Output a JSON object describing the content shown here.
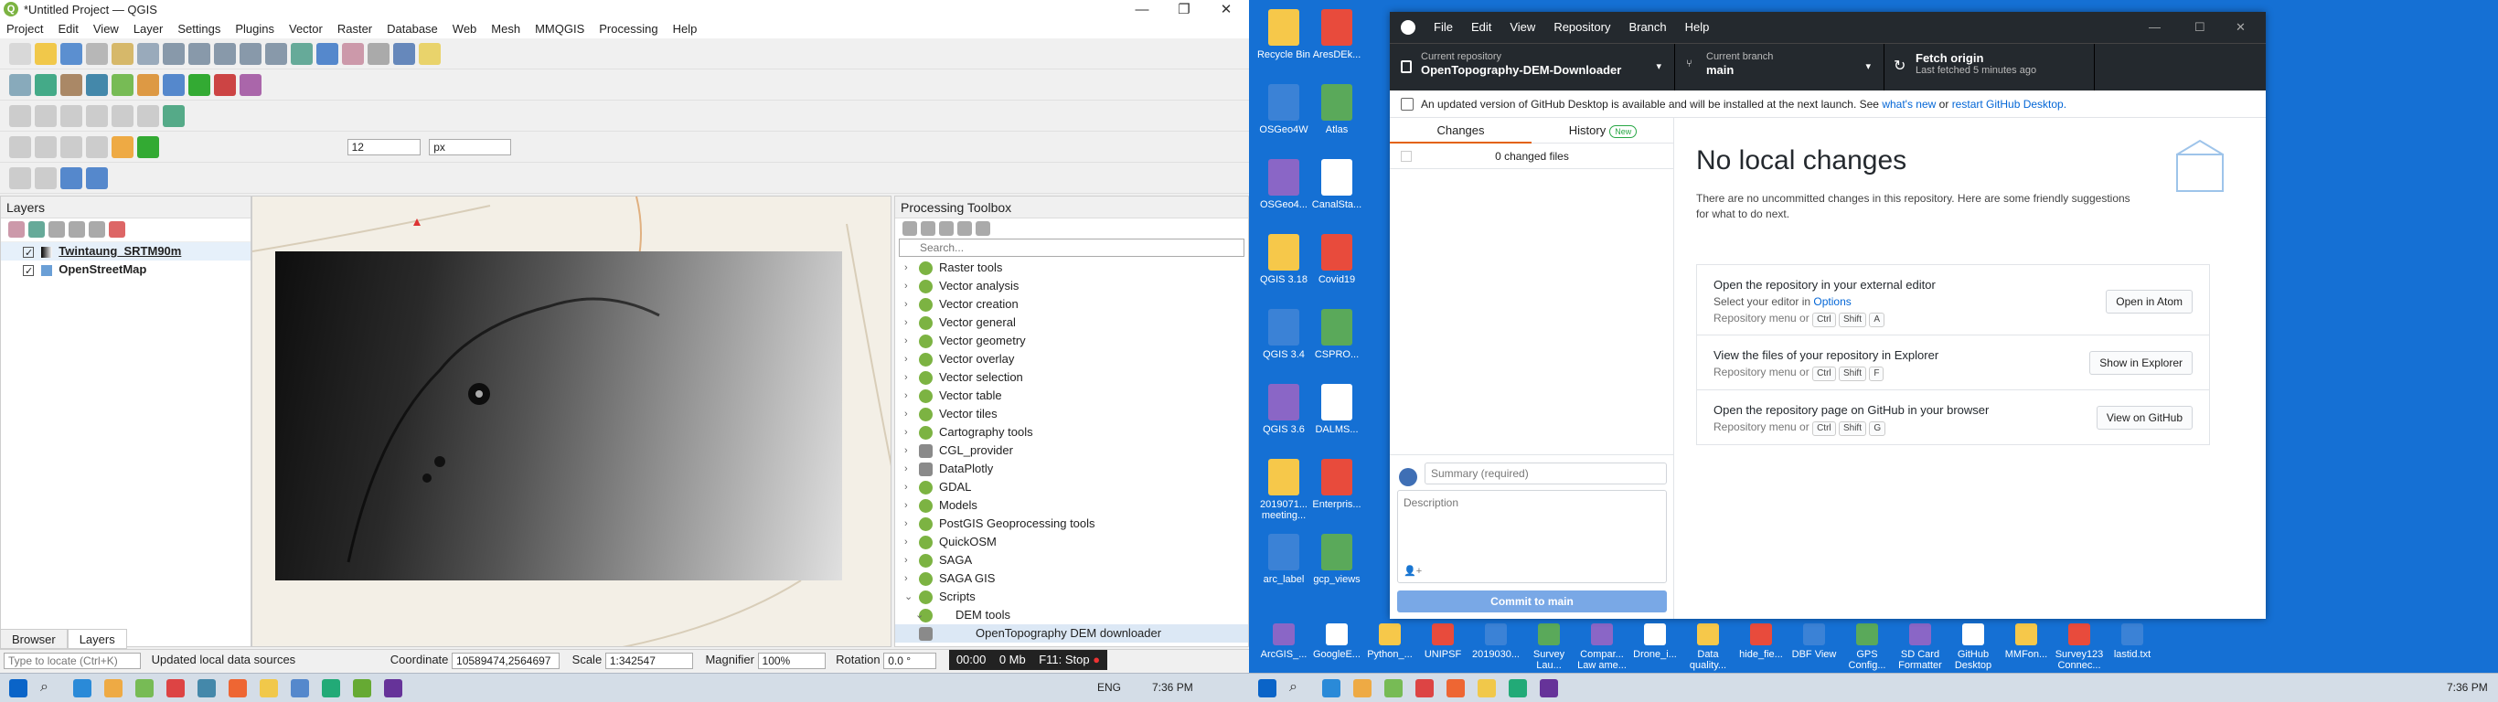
{
  "qgis": {
    "title": "*Untitled Project — QGIS",
    "menu": [
      "Project",
      "Edit",
      "View",
      "Layer",
      "Settings",
      "Plugins",
      "Vector",
      "Raster",
      "Database",
      "Web",
      "Mesh",
      "MMQGIS",
      "Processing",
      "Help"
    ],
    "font_size_value": "12",
    "unit_value": "px",
    "layers_panel": {
      "title": "Layers",
      "items": [
        "Twintaung_SRTM90m",
        "OpenStreetMap"
      ]
    },
    "processing": {
      "title": "Processing Toolbox",
      "search_placeholder": "Search...",
      "groups": [
        "Raster tools",
        "Vector analysis",
        "Vector creation",
        "Vector general",
        "Vector geometry",
        "Vector overlay",
        "Vector selection",
        "Vector table",
        "Vector tiles",
        "Cartography tools",
        "CGL_provider",
        "DataPlotly",
        "GDAL",
        "Models",
        "PostGIS Geoprocessing tools",
        "QuickOSM",
        "SAGA",
        "SAGA GIS",
        "Scripts",
        "DEM tools",
        "OpenTopography DEM downloader"
      ]
    },
    "bottom_tabs": [
      "Browser",
      "Layers"
    ],
    "status": {
      "locate_placeholder": "Type to locate (Ctrl+K)",
      "message": "Updated local data sources",
      "coordinate_label": "Coordinate",
      "coordinate": "10589474,2564697",
      "scale_label": "Scale",
      "scale": "1:342547",
      "magnifier_label": "Magnifier",
      "magnifier": "100%",
      "rotation_label": "Rotation",
      "rotation": "0.0 °",
      "timer": "00:00",
      "rate": "0 Mb",
      "stop": "F11: Stop"
    }
  },
  "desktop_icons": [
    "Recycle Bin",
    "AresDEk...",
    "OSGeo4W",
    "Atlas",
    "OSGeo4...",
    "CanalSta...",
    "QGIS 3.18",
    "Covid19",
    "QGIS 3.4",
    "CSPRO...",
    "QGIS 3.6",
    "DALMS...",
    "2019071... meeting...",
    "Enterpris...",
    "arc_label",
    "gcp_views",
    "ArcGIS_...",
    "GoogleE...",
    "Python_...",
    "UNIPSF",
    "2019030...",
    "Survey Lau...",
    "Compar... Law ame...",
    "Drone_i...",
    "Data quality...",
    "hide_fie...",
    "DBF View",
    "GPS Config...",
    "SD Card Formatter",
    "GitHub Desktop",
    "MMFon...",
    "Survey123 Connec...",
    "lastid.txt"
  ],
  "github": {
    "menu": [
      "File",
      "Edit",
      "View",
      "Repository",
      "Branch",
      "Help"
    ],
    "repo_label": "Current repository",
    "repo": "OpenTopography-DEM-Downloader",
    "branch_label": "Current branch",
    "branch": "main",
    "fetch_title": "Fetch origin",
    "fetch_sub": "Last fetched 5 minutes ago",
    "banner_text": "An updated version of GitHub Desktop is available and will be installed at the next launch. See",
    "banner_link1": "what's new",
    "banner_or": "or",
    "banner_link2": "restart GitHub Desktop.",
    "tab_changes": "Changes",
    "tab_history": "History",
    "new_badge": "New",
    "changed_files": "0 changed files",
    "summary_placeholder": "Summary (required)",
    "description_placeholder": "Description",
    "commit_button": "Commit to main",
    "no_changes_title": "No local changes",
    "no_changes_text": "There are no uncommitted changes in this repository. Here are some friendly suggestions for what to do next.",
    "cards": [
      {
        "title": "Open the repository in your external editor",
        "sub": "Select your editor in",
        "link": "Options",
        "keys_label": "Repository menu or",
        "keys": [
          "Ctrl",
          "Shift",
          "A"
        ],
        "button": "Open in Atom"
      },
      {
        "title": "View the files of your repository in Explorer",
        "sub": "",
        "link": "",
        "keys_label": "Repository menu or",
        "keys": [
          "Ctrl",
          "Shift",
          "F"
        ],
        "button": "Show in Explorer"
      },
      {
        "title": "Open the repository page on GitHub in your browser",
        "sub": "",
        "link": "",
        "keys_label": "Repository menu or",
        "keys": [
          "Ctrl",
          "Shift",
          "G"
        ],
        "button": "View on GitHub"
      }
    ]
  },
  "taskbar_left": {
    "lang": "ENG",
    "time": "7:36 PM"
  },
  "taskbar_right": {
    "time": "7:36 PM"
  }
}
